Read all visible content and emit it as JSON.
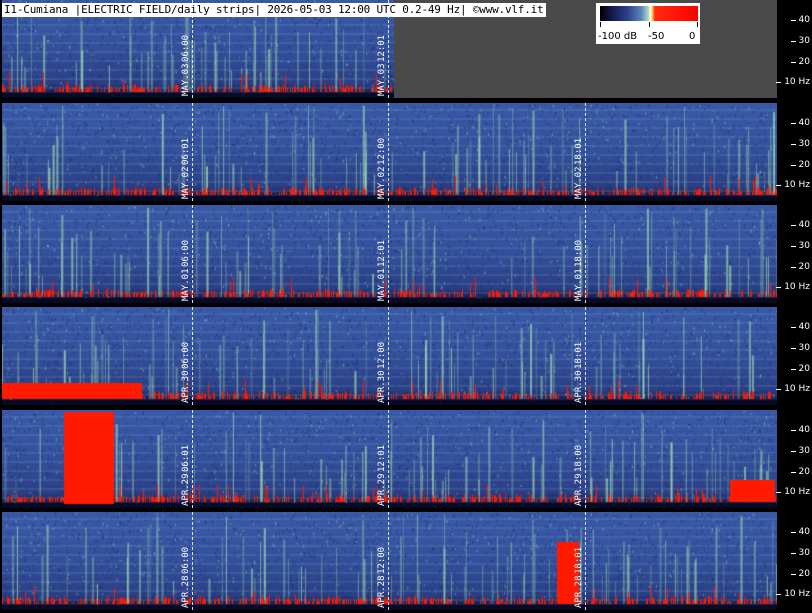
{
  "header": {
    "title": "I1-Cumiana |ELECTRIC FIELD/daily strips| 2026-05-03 12:00 UTC 0.2-49 Hz| ©www.vlf.it"
  },
  "colorbar": {
    "labels": [
      "-100 dB",
      "-50",
      "0"
    ],
    "colors": {
      "low": "#000000",
      "mid": "#5a86b8",
      "high": "#ff0000"
    }
  },
  "axis": {
    "ticks": [
      "40",
      "30",
      "20",
      "10 Hz"
    ]
  },
  "strips": [
    {
      "date": "MAY.03",
      "markers": [
        "06:00",
        "12:01"
      ],
      "partial": true
    },
    {
      "date": "MAY.02",
      "markers": [
        "06:01",
        "12:00",
        "18:01"
      ],
      "partial": false
    },
    {
      "date": "MAY.01",
      "markers": [
        "06:00",
        "12:01",
        "18:00"
      ],
      "partial": false
    },
    {
      "date": "APR.30",
      "markers": [
        "06:00",
        "12:00",
        "18:01"
      ],
      "partial": false
    },
    {
      "date": "APR.29",
      "markers": [
        "06:01",
        "12:01",
        "18:00"
      ],
      "partial": false
    },
    {
      "date": "APR.28",
      "markers": [
        "06:00",
        "12:00",
        "18:01"
      ],
      "partial": false
    }
  ],
  "colors": {
    "background": "#2a3c8e",
    "burst": "#ff1a00",
    "gap": "#4a4a4a"
  }
}
